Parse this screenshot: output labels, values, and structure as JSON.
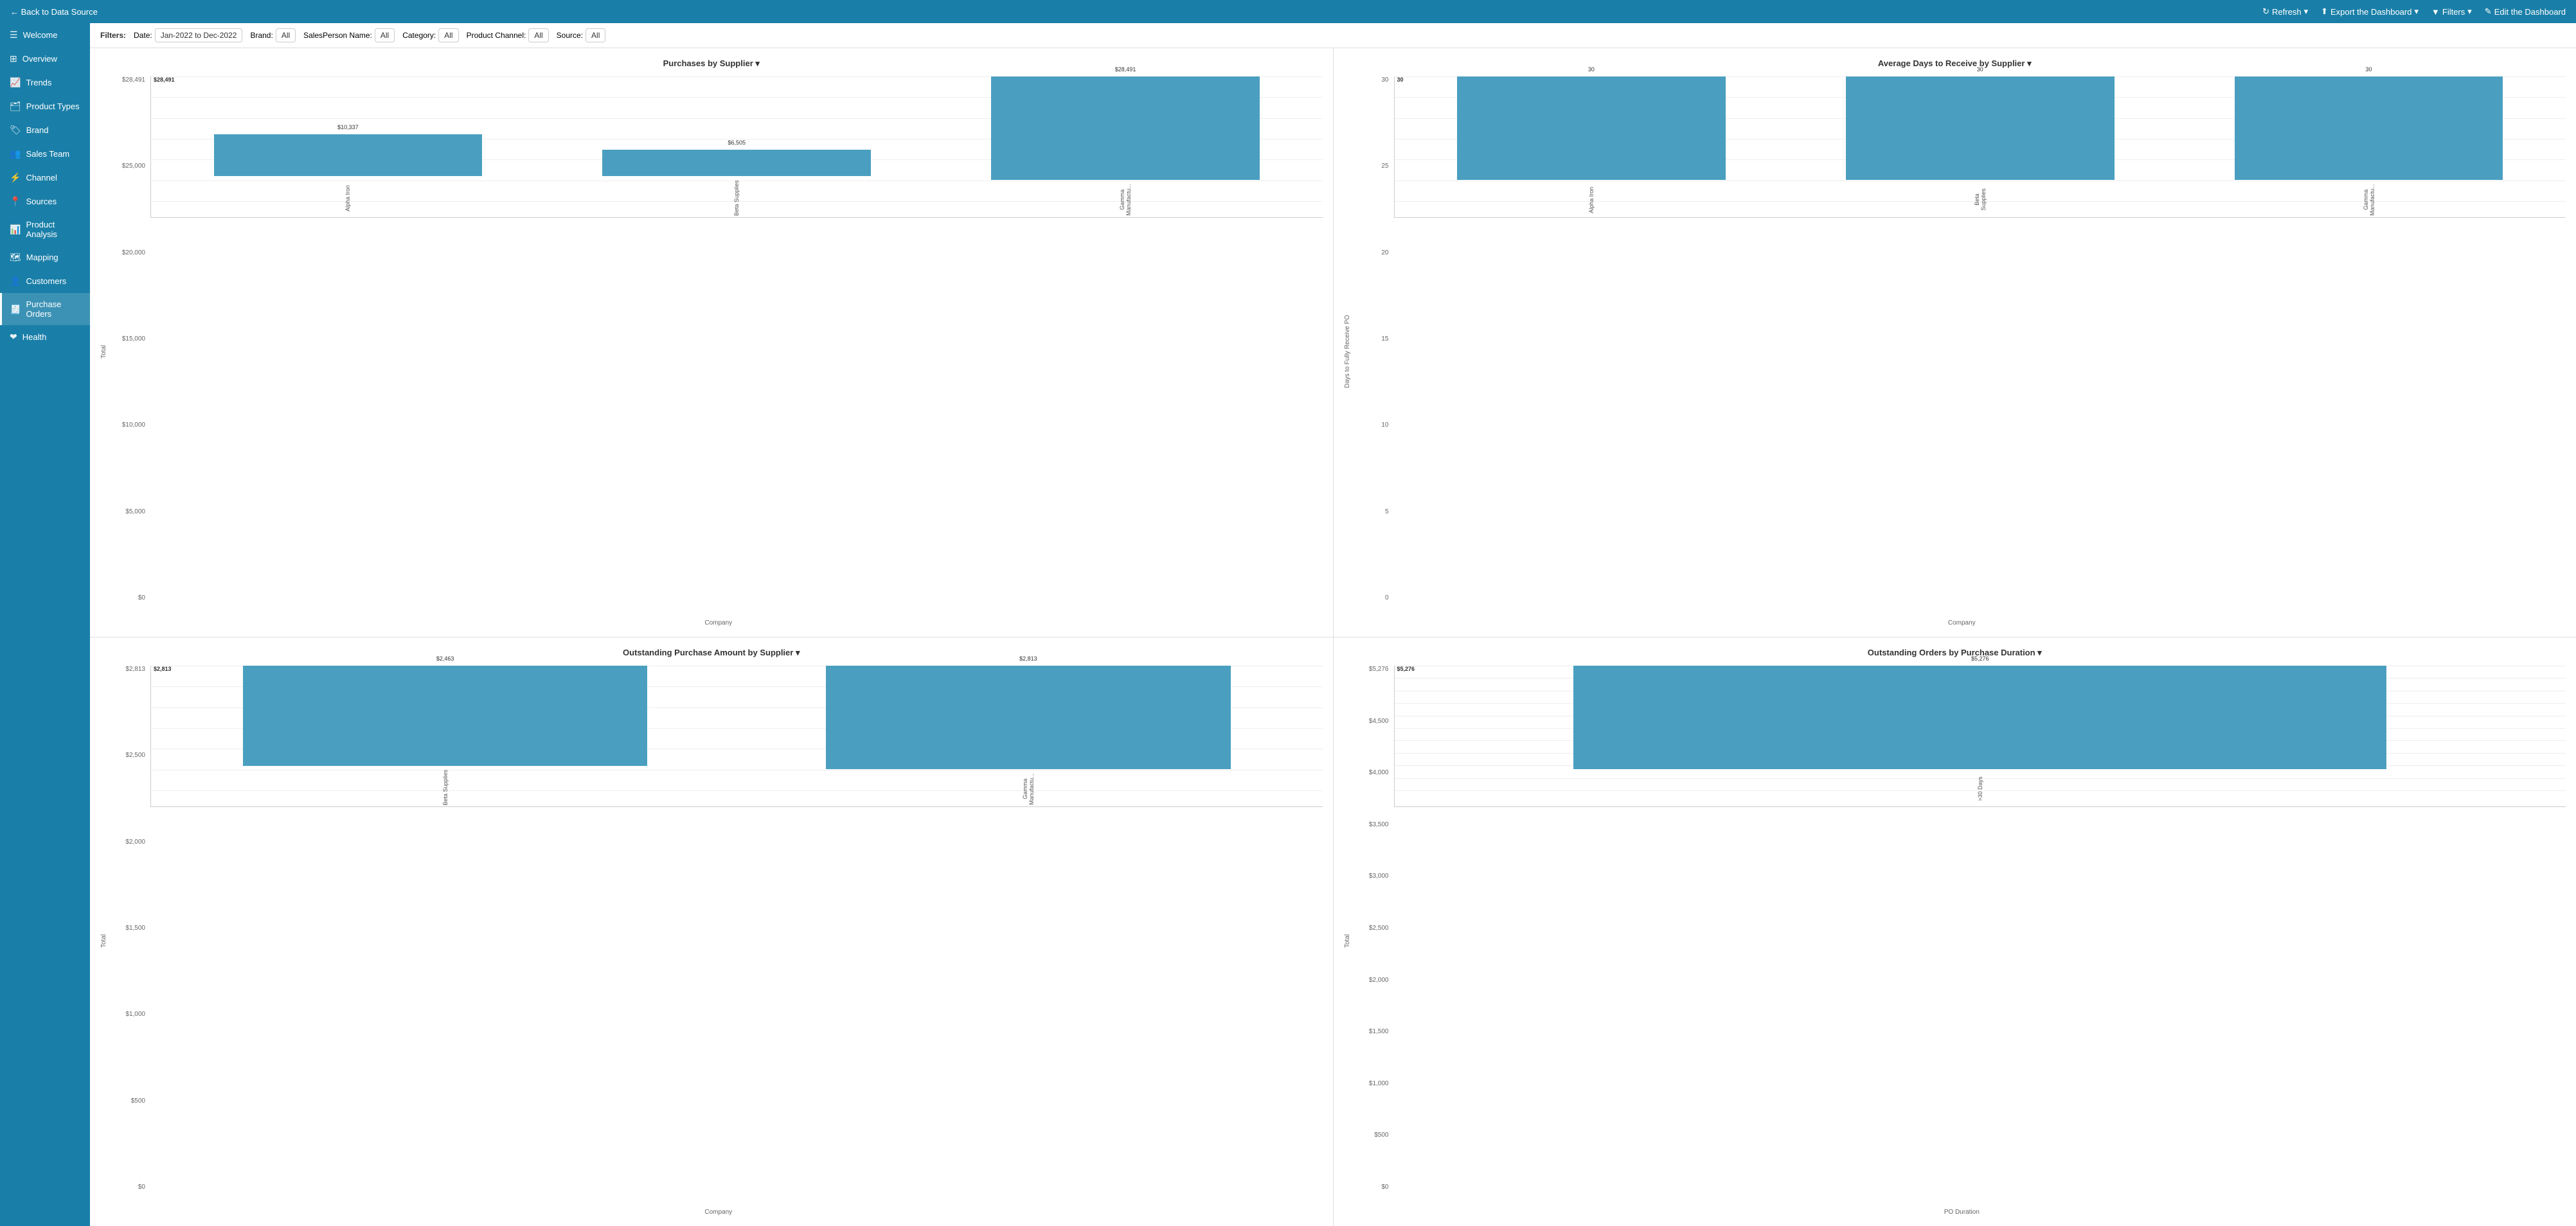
{
  "topbar": {
    "back_label": "← Back to Data Source",
    "refresh_label": "Refresh",
    "export_label": "Export the Dashboard",
    "filters_label": "Filters",
    "edit_label": "Edit the Dashboard"
  },
  "sidebar": {
    "items": [
      {
        "id": "welcome",
        "label": "Welcome",
        "icon": "☰",
        "active": false
      },
      {
        "id": "overview",
        "label": "Overview",
        "icon": "⊞",
        "active": false
      },
      {
        "id": "trends",
        "label": "Trends",
        "icon": "📈",
        "active": false
      },
      {
        "id": "product-types",
        "label": "Product Types",
        "icon": "🗂",
        "active": false
      },
      {
        "id": "brand",
        "label": "Brand",
        "icon": "🏷",
        "active": false
      },
      {
        "id": "sales-team",
        "label": "Sales Team",
        "icon": "👥",
        "active": false
      },
      {
        "id": "channel",
        "label": "Channel",
        "icon": "⚡",
        "active": false
      },
      {
        "id": "sources",
        "label": "Sources",
        "icon": "📍",
        "active": false
      },
      {
        "id": "product-analysis",
        "label": "Product Analysis",
        "icon": "📊",
        "active": false
      },
      {
        "id": "mapping",
        "label": "Mapping",
        "icon": "🗺",
        "active": false
      },
      {
        "id": "customers",
        "label": "Customers",
        "icon": "👤",
        "active": false
      },
      {
        "id": "purchase-orders",
        "label": "Purchase Orders",
        "icon": "🧾",
        "active": true
      },
      {
        "id": "health",
        "label": "Health",
        "icon": "❤",
        "active": false
      }
    ]
  },
  "filters": {
    "label": "Filters:",
    "date_label": "Date:",
    "date_value": "Jan-2022 to Dec-2022",
    "brand_label": "Brand:",
    "brand_value": "All",
    "salesperson_label": "SalesPerson Name:",
    "salesperson_value": "All",
    "category_label": "Category:",
    "category_value": "All",
    "product_channel_label": "Product Channel:",
    "product_channel_value": "All",
    "source_label": "Source:",
    "source_value": "All"
  },
  "chart1": {
    "title": "Purchases by Supplier",
    "y_axis_label": "Total",
    "x_axis_label": "Company",
    "y_ticks": [
      "$0",
      "$5,000",
      "$10,000",
      "$15,000",
      "$20,000",
      "$25,000",
      "$28,491"
    ],
    "max_label": "$28,491",
    "bars": [
      {
        "label": "Alpha Iron",
        "value": 10337,
        "display": "$10,337",
        "pct": 36
      },
      {
        "label": "Beta Supplies",
        "value": 6505,
        "display": "$6,505",
        "pct": 23
      },
      {
        "label": "Gamma Manufactu...",
        "value": 28491,
        "display": "$28,491",
        "pct": 100
      }
    ]
  },
  "chart2": {
    "title": "Average Days to Receive by Supplier",
    "y_axis_label": "Days to Fully Receive PO",
    "x_axis_label": "Company",
    "y_ticks": [
      "0",
      "5",
      "10",
      "15",
      "20",
      "25",
      "30"
    ],
    "max_label": "30",
    "bars": [
      {
        "label": "Alpha Iron",
        "value": 30,
        "display": "30",
        "pct": 100
      },
      {
        "label": "Beta Supplies",
        "value": 30,
        "display": "30",
        "pct": 100
      },
      {
        "label": "Gamma Manufactu...",
        "value": 30,
        "display": "30",
        "pct": 100
      }
    ]
  },
  "chart3": {
    "title": "Outstanding Purchase Amount by Supplier",
    "y_axis_label": "Total",
    "x_axis_label": "Company",
    "y_ticks": [
      "$0",
      "$500",
      "$1,000",
      "$1,500",
      "$2,000",
      "$2,500",
      "$2,813"
    ],
    "max_label": "$2,813",
    "bars": [
      {
        "label": "Beta Supplies",
        "value": 2463,
        "display": "$2,463",
        "pct": 87
      },
      {
        "label": "Gamma Manufactu...",
        "value": 2813,
        "display": "$2,813",
        "pct": 100
      }
    ]
  },
  "chart4": {
    "title": "Outstanding Orders by Purchase Duration",
    "y_axis_label": "Total",
    "x_axis_label": "PO Duration",
    "y_ticks": [
      "$0",
      "$500",
      "$1,000",
      "$1,500",
      "$2,000",
      "$2,500",
      "$3,000",
      "$3,500",
      "$4,000",
      "$4,500",
      "$5,276"
    ],
    "max_label": "$5,276",
    "bars": [
      {
        "label": ">30 Days",
        "value": 5276,
        "display": "$5,276",
        "pct": 100
      }
    ]
  }
}
